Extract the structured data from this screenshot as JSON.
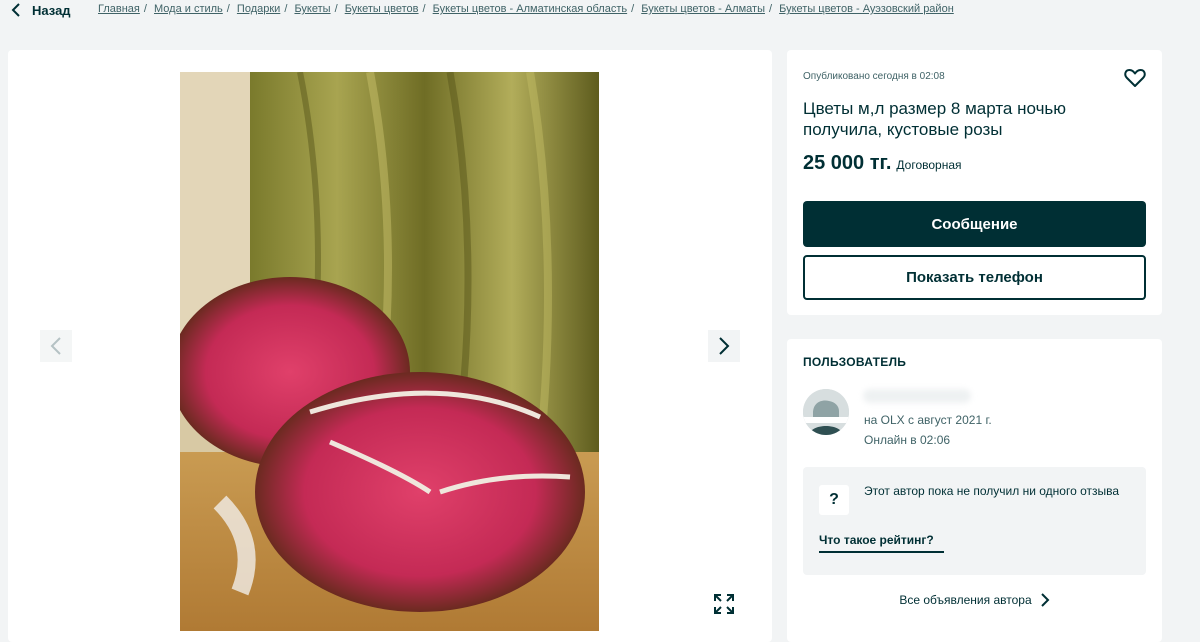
{
  "nav": {
    "back_label": "Назад",
    "breadcrumbs": [
      "Главная",
      "Мода и стиль",
      "Подарки",
      "Букеты",
      "Букеты цветов",
      "Букеты цветов - Алматинская область",
      "Букеты цветов - Алматы",
      "Букеты цветов - Ауэзовский район"
    ]
  },
  "gallery": {
    "prev_icon": "chevron-left-icon",
    "next_icon": "chevron-right-icon",
    "expand_icon": "expand-icon"
  },
  "ad": {
    "posted": "Опубликовано сегодня в 02:08",
    "title": "Цветы м,л размер 8 марта ночью получила, кустовые розы",
    "price": "25 000 тг.",
    "negotiable": "Договорная",
    "message_button": "Сообщение",
    "phone_button": "Показать телефон",
    "favorite_icon": "heart-icon"
  },
  "user": {
    "heading": "ПОЛЬЗОВАТЕЛЬ",
    "since": "на OLX с август 2021 г.",
    "online": "Онлайн в 02:06",
    "rating_text": "Этот автор пока не получил ни одного отзыва",
    "rating_link": "Что такое рейтинг?",
    "all_ads": "Все объявления автора"
  },
  "colors": {
    "primary": "#002f34",
    "background": "#f2f4f5",
    "secondary_text": "#406367"
  }
}
